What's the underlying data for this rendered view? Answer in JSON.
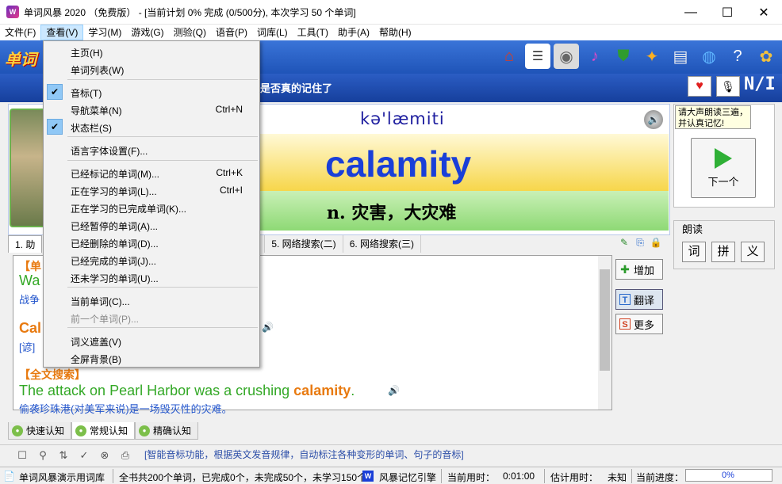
{
  "window": {
    "title": "单词风暴 2020 （免费版） - [当前计划 0% 完成 (0/500分), 本次学习 50 个单词]",
    "app_icon": "W",
    "controls": {
      "minimize": "—",
      "maximize": "☐",
      "close": "✕"
    }
  },
  "menubar": [
    "文件(F)",
    "查看(V)",
    "学习(M)",
    "游戏(G)",
    "测验(Q)",
    "语音(P)",
    "词库(L)",
    "工具(T)",
    "助手(A)",
    "帮助(H)"
  ],
  "logo": "单词",
  "header": {
    "slogan": "是否真的记住了",
    "ni_label": "N/I"
  },
  "word": {
    "phonetic": "kə'læmiti",
    "text": "calamity",
    "definition": "n. 灾害，大灾难"
  },
  "tip": "请大声朗读三遍，并认真记忆!",
  "next_button": "下一个",
  "read_group": {
    "title": "朗读",
    "buttons": [
      "词",
      "拼",
      "义"
    ]
  },
  "tabs": [
    "1. 助",
    "索(-)",
    "5. 网络搜索(二)",
    "6. 网络搜索(三)"
  ],
  "content": {
    "sec1_head": "【单",
    "sec1_eng": "Wa",
    "sec1_cn": "战争",
    "sec2_eng": "Cal",
    "sec2_cn": "[谚]",
    "sec3_head": "【全文搜索】",
    "sentence_pre": "The attack on Pearl Harbor was a crushing ",
    "sentence_word": "calamity",
    "sentence_post": ".",
    "sentence_cn": "偷袭珍珠港(对美军来说)是一场毁灭性的灾难。"
  },
  "side_buttons": [
    "增加",
    "翻译",
    "更多"
  ],
  "mode_tabs": [
    "快速认知",
    "常规认知",
    "精确认知"
  ],
  "hint": "[智能音标功能，根据英文发音规律，自动标注各种变形的单词、句子的音标]",
  "status": {
    "library": "单词风暴演示用词库",
    "summary": "全书共200个单词，已完成0个，未完成50个，未学习150个",
    "engine": "风暴记忆引擎",
    "time_label": "当前用时：",
    "time_value": "0:01:00",
    "est_label": "估计用时：",
    "est_value": "未知",
    "progress_label": "当前进度：",
    "progress_text": "0%",
    "progress_value": 0
  },
  "view_menu": {
    "items": [
      {
        "label": "主页(H)",
        "shortcut": "",
        "checked": false,
        "disabled": false
      },
      {
        "label": "单词列表(W)",
        "shortcut": "",
        "checked": false,
        "disabled": false
      },
      {
        "label": "音标(T)",
        "shortcut": "",
        "checked": true,
        "disabled": false
      },
      {
        "label": "导航菜单(N)",
        "shortcut": "Ctrl+N",
        "checked": false,
        "disabled": false
      },
      {
        "label": "状态栏(S)",
        "shortcut": "",
        "checked": true,
        "disabled": false
      },
      {
        "label": "语言字体设置(F)...",
        "shortcut": "",
        "checked": false,
        "disabled": false
      },
      {
        "label": "已经标记的单词(M)...",
        "shortcut": "Ctrl+K",
        "checked": false,
        "disabled": false
      },
      {
        "label": "正在学习的单词(L)...",
        "shortcut": "Ctrl+I",
        "checked": false,
        "disabled": false
      },
      {
        "label": "正在学习的已完成单词(K)...",
        "shortcut": "",
        "checked": false,
        "disabled": false
      },
      {
        "label": "已经暂停的单词(A)...",
        "shortcut": "",
        "checked": false,
        "disabled": false
      },
      {
        "label": "已经删除的单词(D)...",
        "shortcut": "",
        "checked": false,
        "disabled": false
      },
      {
        "label": "已经完成的单词(J)...",
        "shortcut": "",
        "checked": false,
        "disabled": false
      },
      {
        "label": "还未学习的单词(U)...",
        "shortcut": "",
        "checked": false,
        "disabled": false
      },
      {
        "label": "当前单词(C)...",
        "shortcut": "",
        "checked": false,
        "disabled": false
      },
      {
        "label": "前一个单词(P)...",
        "shortcut": "",
        "checked": false,
        "disabled": true
      },
      {
        "label": "词义遮盖(V)",
        "shortcut": "",
        "checked": false,
        "disabled": false
      },
      {
        "label": "全屏背景(B)",
        "shortcut": "",
        "checked": false,
        "disabled": false
      }
    ]
  }
}
